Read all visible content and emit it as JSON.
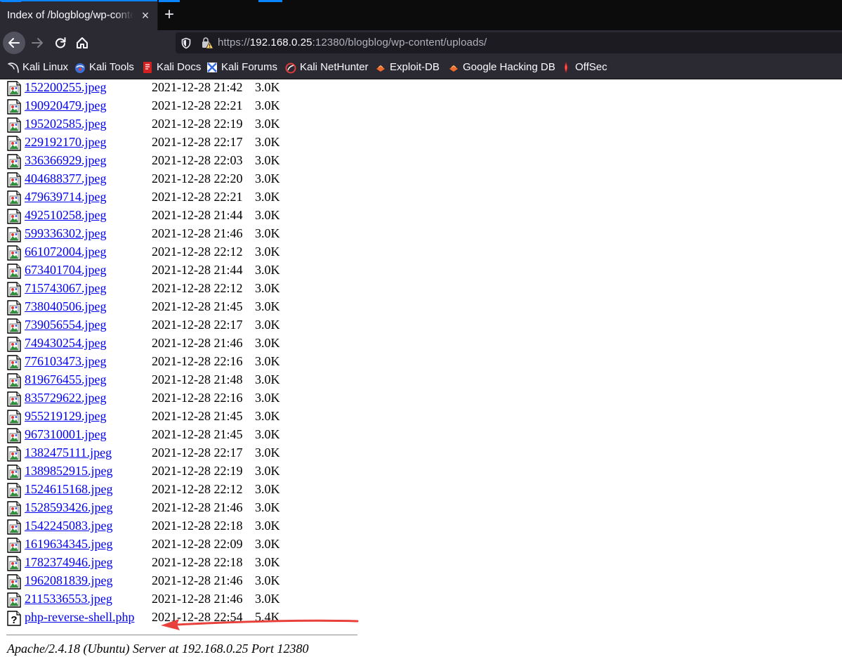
{
  "browser": {
    "tab_title": "Index of /blogblog/wp-content/uploads/",
    "tab_close": "×",
    "new_tab": "+",
    "url": {
      "scheme": "https://",
      "host": "192.168.0.25",
      "rest": ":12380/blogblog/wp-content/uploads/"
    },
    "accent_color": "#0a84ff"
  },
  "bookmarks": [
    {
      "label": "Kali Linux",
      "icon": "kali-dragon-icon"
    },
    {
      "label": "Kali Tools",
      "icon": "kali-tools-icon"
    },
    {
      "label": "Kali Docs",
      "icon": "kali-docs-icon"
    },
    {
      "label": "Kali Forums",
      "icon": "kali-forums-icon"
    },
    {
      "label": "Kali NetHunter",
      "icon": "kali-nethunter-icon"
    },
    {
      "label": "Exploit-DB",
      "icon": "exploit-db-icon"
    },
    {
      "label": "Google Hacking DB",
      "icon": "google-hacking-db-icon"
    },
    {
      "label": "OffSec",
      "icon": "offsec-icon"
    }
  ],
  "files": [
    {
      "name": "152200255.jpeg",
      "date": "2021-12-28 21:42",
      "size": "3.0K",
      "type": "image"
    },
    {
      "name": "190920479.jpeg",
      "date": "2021-12-28 22:21",
      "size": "3.0K",
      "type": "image"
    },
    {
      "name": "195202585.jpeg",
      "date": "2021-12-28 22:19",
      "size": "3.0K",
      "type": "image"
    },
    {
      "name": "229192170.jpeg",
      "date": "2021-12-28 22:17",
      "size": "3.0K",
      "type": "image"
    },
    {
      "name": "336366929.jpeg",
      "date": "2021-12-28 22:03",
      "size": "3.0K",
      "type": "image"
    },
    {
      "name": "404688377.jpeg",
      "date": "2021-12-28 22:20",
      "size": "3.0K",
      "type": "image"
    },
    {
      "name": "479639714.jpeg",
      "date": "2021-12-28 22:21",
      "size": "3.0K",
      "type": "image"
    },
    {
      "name": "492510258.jpeg",
      "date": "2021-12-28 21:44",
      "size": "3.0K",
      "type": "image"
    },
    {
      "name": "599336302.jpeg",
      "date": "2021-12-28 21:46",
      "size": "3.0K",
      "type": "image"
    },
    {
      "name": "661072004.jpeg",
      "date": "2021-12-28 22:12",
      "size": "3.0K",
      "type": "image"
    },
    {
      "name": "673401704.jpeg",
      "date": "2021-12-28 21:44",
      "size": "3.0K",
      "type": "image"
    },
    {
      "name": "715743067.jpeg",
      "date": "2021-12-28 22:12",
      "size": "3.0K",
      "type": "image"
    },
    {
      "name": "738040506.jpeg",
      "date": "2021-12-28 21:45",
      "size": "3.0K",
      "type": "image"
    },
    {
      "name": "739056554.jpeg",
      "date": "2021-12-28 22:17",
      "size": "3.0K",
      "type": "image"
    },
    {
      "name": "749430254.jpeg",
      "date": "2021-12-28 21:46",
      "size": "3.0K",
      "type": "image"
    },
    {
      "name": "776103473.jpeg",
      "date": "2021-12-28 22:16",
      "size": "3.0K",
      "type": "image"
    },
    {
      "name": "819676455.jpeg",
      "date": "2021-12-28 21:48",
      "size": "3.0K",
      "type": "image"
    },
    {
      "name": "835729622.jpeg",
      "date": "2021-12-28 22:16",
      "size": "3.0K",
      "type": "image"
    },
    {
      "name": "955219129.jpeg",
      "date": "2021-12-28 21:45",
      "size": "3.0K",
      "type": "image"
    },
    {
      "name": "967310001.jpeg",
      "date": "2021-12-28 21:45",
      "size": "3.0K",
      "type": "image"
    },
    {
      "name": "1382475111.jpeg",
      "date": "2021-12-28 22:17",
      "size": "3.0K",
      "type": "image"
    },
    {
      "name": "1389852915.jpeg",
      "date": "2021-12-28 22:19",
      "size": "3.0K",
      "type": "image"
    },
    {
      "name": "1524615168.jpeg",
      "date": "2021-12-28 22:12",
      "size": "3.0K",
      "type": "image"
    },
    {
      "name": "1528593426.jpeg",
      "date": "2021-12-28 21:46",
      "size": "3.0K",
      "type": "image"
    },
    {
      "name": "1542245083.jpeg",
      "date": "2021-12-28 22:18",
      "size": "3.0K",
      "type": "image"
    },
    {
      "name": "1619634345.jpeg",
      "date": "2021-12-28 22:09",
      "size": "3.0K",
      "type": "image"
    },
    {
      "name": "1782374946.jpeg",
      "date": "2021-12-28 22:18",
      "size": "3.0K",
      "type": "image"
    },
    {
      "name": "1962081839.jpeg",
      "date": "2021-12-28 21:46",
      "size": "3.0K",
      "type": "image"
    },
    {
      "name": "2115336553.jpeg",
      "date": "2021-12-28 21:46",
      "size": "3.0K",
      "type": "image"
    },
    {
      "name": "php-reverse-shell.php",
      "date": "2021-12-28 22:54",
      "size": "5.4K",
      "type": "unknown"
    }
  ],
  "server_signature": "Apache/2.4.18 (Ubuntu) Server at 192.168.0.25 Port 12380",
  "annotation": {
    "type": "arrow",
    "color": "#e8413c",
    "points_to": "php-reverse-shell.php"
  }
}
